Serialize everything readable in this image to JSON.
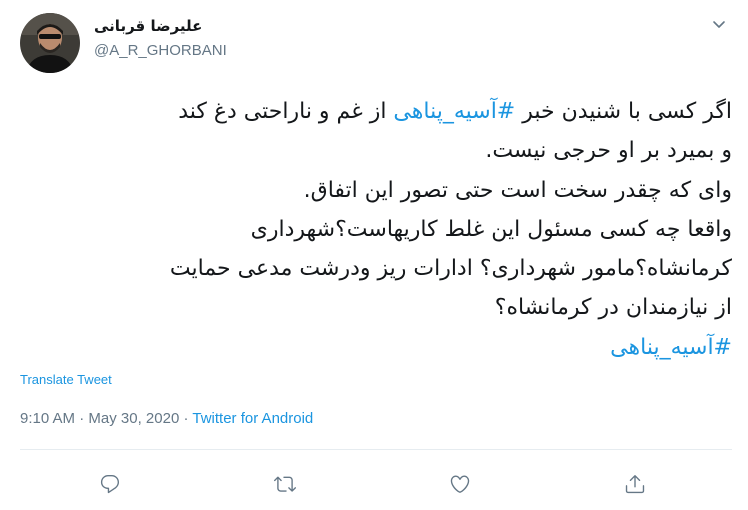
{
  "author": {
    "display_name": "علیرضا قربانی",
    "handle": "@A_R_GHORBANI"
  },
  "tweet": {
    "lines": [
      [
        {
          "text": "اگر کسی با شنیدن خبر ",
          "hashtag": false
        },
        {
          "text": "#آسیه_پناهی",
          "hashtag": true
        },
        {
          "text": " از غم و ناراحتی دغ کند",
          "hashtag": false
        }
      ],
      [
        {
          "text": "و بمیرد بر او حرجی نیست.",
          "hashtag": false
        }
      ],
      [
        {
          "text": "وای که چقدر سخت است حتی تصور این اتفاق.",
          "hashtag": false
        }
      ],
      [
        {
          "text": "واقعا چه کسی مسئول این غلط کاریهاست؟شهرداری",
          "hashtag": false
        }
      ],
      [
        {
          "text": "کرمانشاه؟مامور شهرداری؟ ادارات ریز ودرشت مدعی حمایت",
          "hashtag": false
        }
      ],
      [
        {
          "text": "از نیازمندان در کرمانشاه؟",
          "hashtag": false
        }
      ],
      [
        {
          "text": "#آسیه_پناهی",
          "hashtag": true
        }
      ]
    ],
    "translate_label": "Translate Tweet",
    "time": "9:10 AM",
    "separator": "·",
    "date": "May 30, 2020",
    "source": "Twitter for Android"
  },
  "icons": {
    "caret": "chevron-down-icon",
    "reply": "reply-icon",
    "retweet": "retweet-icon",
    "like": "heart-icon",
    "share": "share-icon"
  },
  "colors": {
    "link": "#1b95e0",
    "text": "#14171a",
    "muted": "#657786",
    "divider": "#e6ecf0"
  }
}
